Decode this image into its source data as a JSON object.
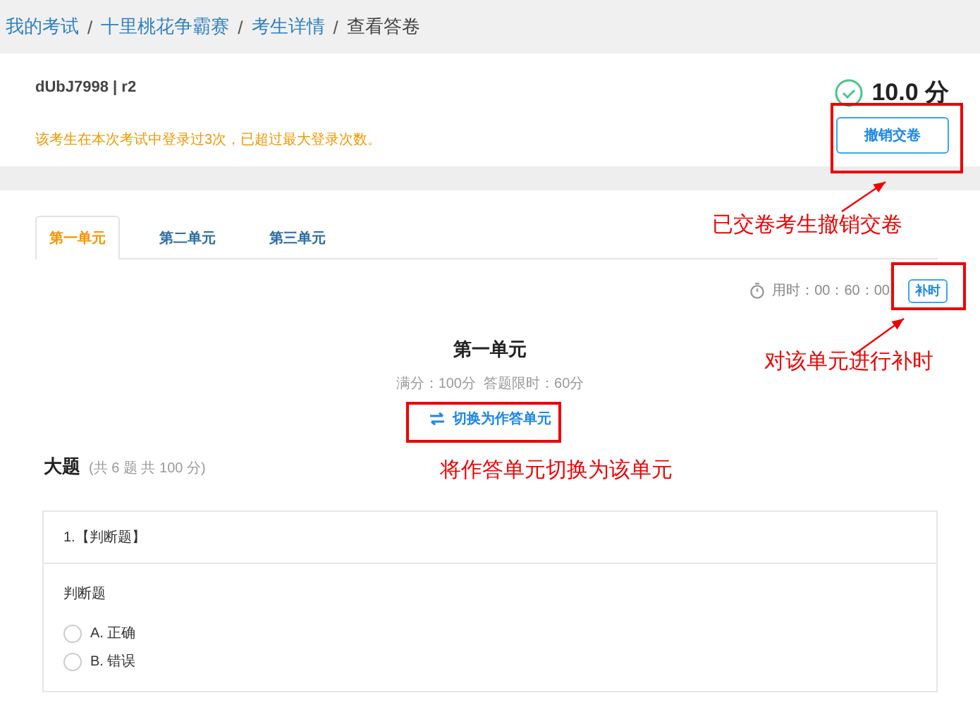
{
  "breadcrumb": [
    {
      "label": "我的考试",
      "link": true
    },
    {
      "separator": "/",
      "label": "十里桃花争霸赛",
      "link": true
    },
    {
      "separator": "/",
      "label": "考生详情",
      "link": true
    },
    {
      "separator": "/",
      "label": "查看答卷",
      "link": false
    }
  ],
  "candidate": {
    "id": "dUbJ7998 | r2",
    "warning": "该考生在本次考试中登录过3次，已超过最大登录次数。",
    "score": "10.0 分",
    "revoke_button": "撤销交卷"
  },
  "tabs": [
    {
      "label": "第一单元",
      "selected": true
    },
    {
      "label": "第二单元",
      "selected": false
    },
    {
      "label": "第三单元",
      "selected": false
    }
  ],
  "timer": {
    "label": "用时：00：60：00",
    "extra_button": "补时"
  },
  "unit": {
    "title": "第一单元",
    "meta": "满分：100分  答题限时：60分",
    "switch_button": "切换为作答单元"
  },
  "section": {
    "title": "大题",
    "summary": "(共 6 题 共 100 分)"
  },
  "question": {
    "title": "1.【判断题】",
    "prompt": "判断题",
    "options": [
      {
        "label": "A. 正确",
        "selected": false
      },
      {
        "label": "B. 错误",
        "selected": false
      }
    ]
  },
  "annotations": [
    {
      "text": "已交卷考生撤销交卷"
    },
    {
      "text": "对该单元进行补时"
    },
    {
      "text": "将作答单元切换为该单元"
    }
  ]
}
